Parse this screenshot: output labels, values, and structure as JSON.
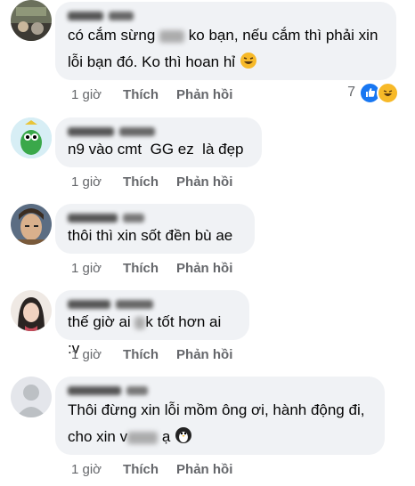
{
  "comments": [
    {
      "text_parts": [
        "có cắm sừng",
        "ko bạn, nếu cắm thì phải xin\nlỗi bạn đó. Ko thì hoan hỉ"
      ],
      "time": "1 giờ",
      "like": "Thích",
      "reply": "Phản hồi",
      "reaction_count": "7"
    },
    {
      "text": "n9 vào cmt  GG ez  là đẹp",
      "time": "1 giờ",
      "like": "Thích",
      "reply": "Phản hồi"
    },
    {
      "text": "thôi thì xin sốt đền bù ae",
      "time": "1 giờ",
      "like": "Thích",
      "reply": "Phản hồi"
    },
    {
      "text_parts": [
        "thế giờ ai ",
        "k tốt hơn ai :v"
      ],
      "time": "1 giờ",
      "like": "Thích",
      "reply": "Phản hồi"
    },
    {
      "text_parts": [
        "Thôi đừng xin lỗi mồm ông ơi, hành động đi,\ncho xin v",
        " ạ"
      ],
      "time": "1 giờ",
      "like": "Thích",
      "reply": "Phản hồi"
    }
  ],
  "colors": {
    "like_blue": "#1877f2",
    "haha_yellow": "#f7b928",
    "bubble_bg": "#f0f2f5",
    "meta_gray": "#65676b"
  }
}
